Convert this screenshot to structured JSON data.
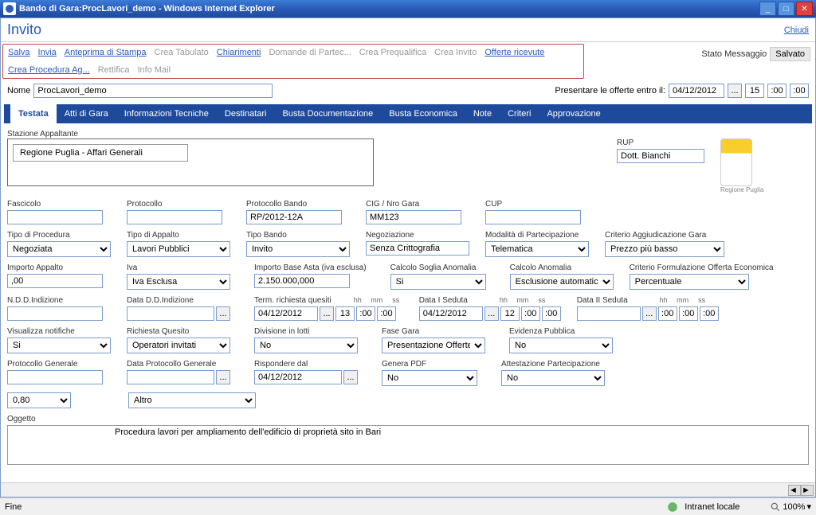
{
  "titlebar": {
    "text": "Bando di Gara:ProcLavori_demo - Windows Internet Explorer"
  },
  "page": {
    "title": "Invito",
    "close": "Chiudi"
  },
  "cmd": {
    "salva": "Salva",
    "invia": "Invia",
    "anteprima": "Anteprima di Stampa",
    "crea_tabulato": "Crea Tabulato",
    "chiarimenti": "Chiarimenti",
    "domande": "Domande di Partec...",
    "crea_prequalifica": "Crea Prequalifica",
    "crea_invito": "Crea Invito",
    "offerte_ricevute": "Offerte ricevute",
    "crea_procedura": "Crea Procedura Ag...",
    "rettifica": "Rettifica",
    "info_mail": "Info Mail"
  },
  "status": {
    "label": "Stato Messaggio",
    "value": "Salvato"
  },
  "nome": {
    "label": "Nome",
    "value": "ProcLavori_demo"
  },
  "offerte": {
    "label": "Presentare le offerte entro il:",
    "date": "04/12/2012",
    "hh": "15",
    "mm": ":00",
    "ss": ":00"
  },
  "tabs": {
    "testata": "Testata",
    "atti": "Atti di Gara",
    "info": "Informazioni Tecniche",
    "destinatari": "Destinatari",
    "busta_doc": "Busta Documentazione",
    "busta_eco": "Busta Economica",
    "note": "Note",
    "criteri": "Criteri",
    "approvazione": "Approvazione"
  },
  "stazione": {
    "label": "Stazione Appaltante",
    "value": "Regione Puglia - Affari Generali"
  },
  "rup": {
    "label": "RUP",
    "value": "Dott. Bianchi"
  },
  "logo_caption": "Regione Puglia",
  "fields": {
    "fascicolo": {
      "label": "Fascicolo",
      "value": ""
    },
    "protocollo": {
      "label": "Protocollo",
      "value": ""
    },
    "protocollo_bando": {
      "label": "Protocollo Bando",
      "value": "RP/2012-12A"
    },
    "cig": {
      "label": "CIG / Nro Gara",
      "value": "MM123"
    },
    "cup": {
      "label": "CUP",
      "value": ""
    },
    "tipo_procedura": {
      "label": "Tipo di Procedura",
      "value": "Negoziata"
    },
    "tipo_appalto": {
      "label": "Tipo di Appalto",
      "value": "Lavori Pubblici"
    },
    "tipo_bando": {
      "label": "Tipo Bando",
      "value": "Invito"
    },
    "negoziazione": {
      "label": "Negoziazione",
      "value": "Senza Crittografia"
    },
    "modalita": {
      "label": "Modalità di Partecipazione",
      "value": "Telematica"
    },
    "criterio_agg": {
      "label": "Criterio Aggiudicazione Gara",
      "value": "Prezzo più basso"
    },
    "importo_appalto": {
      "label": "Importo Appalto",
      "value": ",00"
    },
    "iva": {
      "label": "Iva",
      "value": "Iva Esclusa"
    },
    "importo_base": {
      "label": "Importo Base Asta (iva esclusa)",
      "value": "2.150.000,000"
    },
    "calcolo_soglia": {
      "label": "Calcolo Soglia Anomalia",
      "value": "Si"
    },
    "calcolo_anomalia": {
      "label": "Calcolo Anomalia",
      "value": "Esclusione automatica"
    },
    "criterio_form": {
      "label": "Criterio Formulazione Offerta Economica",
      "value": "Percentuale"
    },
    "ndd": {
      "label": "N.D.D.Indizione",
      "value": ""
    },
    "data_dd": {
      "label": "Data D.D.Indizione",
      "value": ""
    },
    "term_quesiti": {
      "label": "Term. richiesta quesiti",
      "value": "04/12/2012",
      "hh": "13",
      "mm": ":00",
      "ss": ":00"
    },
    "data_i_seduta": {
      "label": "Data I Seduta",
      "value": "04/12/2012",
      "hh": "12",
      "mm": ":00",
      "ss": ":00"
    },
    "data_ii_seduta": {
      "label": "Data II Seduta",
      "value": "",
      "hh": ":00",
      "mm": ":00",
      "ss": ":00"
    },
    "visualizza": {
      "label": "Visualizza notifiche",
      "value": "Si"
    },
    "richiesta": {
      "label": "Richiesta Quesito",
      "value": "Operatori invitati"
    },
    "divisione": {
      "label": "Divisione in lotti",
      "value": "No"
    },
    "fase_gara": {
      "label": "Fase Gara",
      "value": "Presentazione Offerte"
    },
    "evidenza": {
      "label": "Evidenza Pubblica",
      "value": "No"
    },
    "protocollo_gen": {
      "label": "Protocollo Generale",
      "value": ""
    },
    "data_protocollo_gen": {
      "label": "Data Protocollo Generale",
      "value": ""
    },
    "rispondere_dal": {
      "label": "Rispondere dal",
      "value": "04/12/2012"
    },
    "genera_pdf": {
      "label": "Genera PDF",
      "value": "No"
    },
    "attestazione": {
      "label": "Attestazione Partecipazione",
      "value": "No"
    },
    "unk1": {
      "value": "0,80"
    },
    "unk2": {
      "value": "Altro"
    }
  },
  "time_labels": {
    "hh": "hh",
    "mm": "mm",
    "ss": "ss"
  },
  "oggetto": {
    "label": "Oggetto",
    "value": "Procedura lavori per ampliamento dell'edificio di proprietà sito in Bari"
  },
  "statusbar": {
    "fine": "Fine",
    "zone": "Intranet locale",
    "zoom_label": "100%"
  }
}
